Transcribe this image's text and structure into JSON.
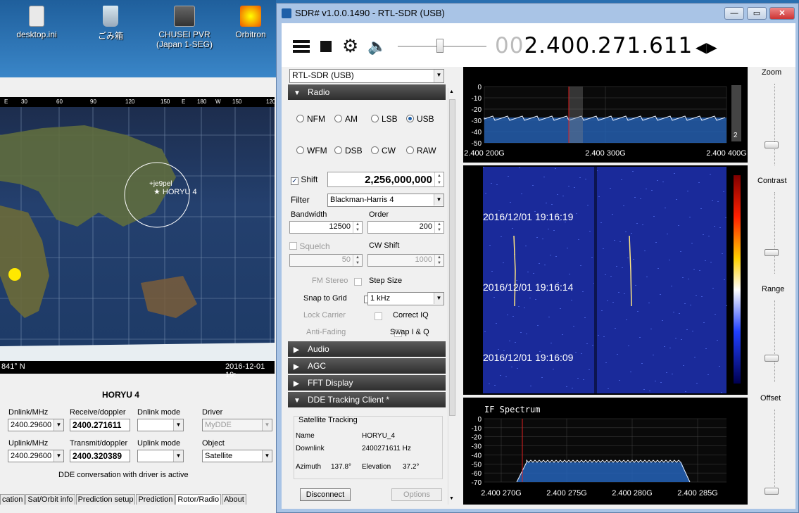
{
  "desktop": {
    "icons": [
      {
        "label": "desktop.ini"
      },
      {
        "label": "ごみ箱"
      },
      {
        "label": "CHUSEI PVR\n(Japan 1-SEG)"
      },
      {
        "label": "Orbitron"
      }
    ]
  },
  "orbitron": {
    "ruler_labels": [
      "E",
      "30",
      "60",
      "90",
      "120",
      "150",
      "E",
      "180",
      "W",
      "150",
      "120"
    ],
    "map_labels": {
      "station": "+je9pel",
      "satellite": "★ HORYU 4"
    },
    "status_left": "841° N",
    "status_right": "2016-12-01 19:",
    "sat_name": "HORYU 4",
    "dnlink_label": "Dnlink/MHz",
    "dnlink_value": "2400.29600",
    "receive_label": "Receive/doppler",
    "receive_value": "2400.271611",
    "dnmode_label": "Dnlink mode",
    "dnmode_value": "",
    "driver_label": "Driver",
    "driver_value": "MyDDE",
    "uplink_label": "Uplink/MHz",
    "uplink_value": "2400.29600",
    "transmit_label": "Transmit/doppler",
    "transmit_value": "2400.320389",
    "upmode_label": "Uplink mode",
    "upmode_value": "",
    "object_label": "Object",
    "object_value": "Satellite",
    "dde_status": "DDE conversation with driver is active",
    "tabs": [
      "cation",
      "Sat/Orbit info",
      "Prediction setup",
      "Prediction",
      "Rotor/Radio",
      "About"
    ]
  },
  "sdr": {
    "title": "SDR# v1.0.0.1490 - RTL-SDR (USB)",
    "freq_dim": "00",
    "freq": "2.400.271.611",
    "device": "RTL-SDR (USB)",
    "sections": {
      "radio": "Radio",
      "audio": "Audio",
      "agc": "AGC",
      "fft": "FFT Display",
      "dde": "DDE Tracking Client *"
    },
    "modes": [
      "NFM",
      "AM",
      "LSB",
      "USB",
      "WFM",
      "DSB",
      "CW",
      "RAW"
    ],
    "selected_mode": "USB",
    "shift_label": "Shift",
    "shift_value": "2,256,000,000",
    "filter_label": "Filter",
    "filter_value": "Blackman-Harris 4",
    "bandwidth_label": "Bandwidth",
    "bandwidth_value": "12500",
    "order_label": "Order",
    "order_value": "200",
    "squelch_label": "Squelch",
    "squelch_value": "50",
    "cwshift_label": "CW Shift",
    "cwshift_value": "1000",
    "fmstereo_label": "FM Stereo",
    "stepsize_label": "Step Size",
    "snap_label": "Snap to Grid",
    "step_value": "1 kHz",
    "lockcarrier_label": "Lock Carrier",
    "correctiq_label": "Correct IQ",
    "antifading_label": "Anti-Fading",
    "swapiq_label": "Swap I & Q",
    "tracking": {
      "group": "Satellite Tracking",
      "name_label": "Name",
      "name_value": "HORYU_4",
      "downlink_label": "Downlink",
      "downlink_value": "2400271611 Hz",
      "azimuth_label": "Azimuth",
      "azimuth_value": "137.8°",
      "elevation_label": "Elevation",
      "elevation_value": "37.2°",
      "disconnect": "Disconnect",
      "options": "Options"
    },
    "spectrum": {
      "y_ticks": [
        "0",
        "-10",
        "-20",
        "-30",
        "-40",
        "-50"
      ],
      "x_ticks": [
        "2.400 200G",
        "2.400 300G",
        "2.400 400G"
      ],
      "badge": "2"
    },
    "waterfall": {
      "timestamps": [
        "2016/12/01 19:16:19",
        "2016/12/01 19:16:14",
        "2016/12/01 19:16:09"
      ]
    },
    "if_spectrum": {
      "title": "IF Spectrum",
      "y_ticks": [
        "0",
        "-10",
        "-20",
        "-30",
        "-40",
        "-50",
        "-60",
        "-70"
      ],
      "x_ticks": [
        "2.400 270G",
        "2.400 275G",
        "2.400 280G",
        "2.400 285G"
      ]
    },
    "side_sliders": [
      "Zoom",
      "Contrast",
      "Range",
      "Offset"
    ]
  }
}
